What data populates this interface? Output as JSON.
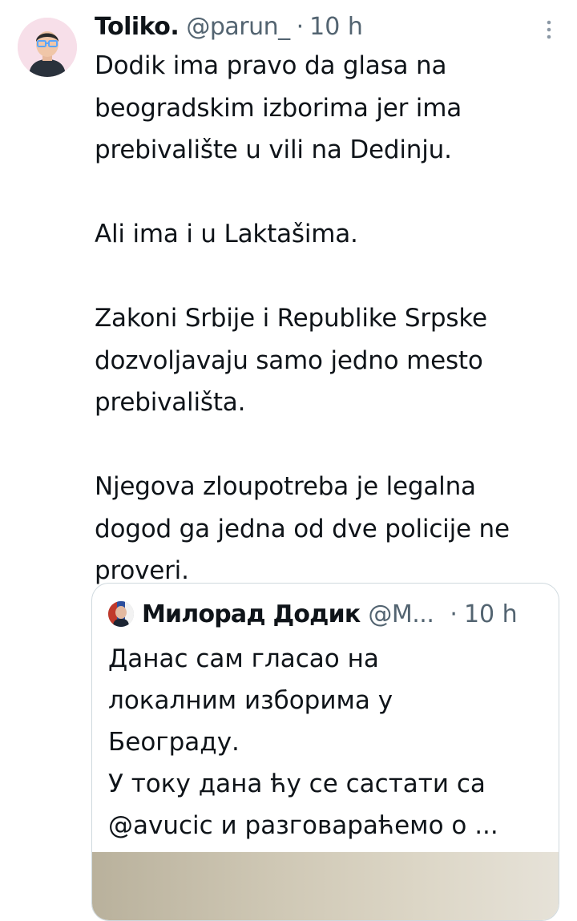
{
  "tweet": {
    "author": {
      "display_name": "Toliko.",
      "handle": "@parun_",
      "separator": "·",
      "time": "10 h"
    },
    "paragraphs": [
      "Dodik ima pravo da glasa na beogradskim izborima jer ima prebivalište u vili na Dedinju.",
      "Ali ima i u Laktašima.",
      "Zakoni Srbije i Republike Srpske dozvoljavaju samo jedno mesto prebivališta.",
      "Njegova zloupotreba je legalna dogod ga jedna od dve policije ne proveri."
    ],
    "icons": {
      "avatar": "avatar-illustration-icon",
      "more": "more-options-icon"
    }
  },
  "quoted_tweet": {
    "author": {
      "display_name": "Милорад Додик",
      "handle": "@M...",
      "separator": "·",
      "time": "10 h"
    },
    "lines": [
      "Данас сам гласао на",
      "локалним изборима у",
      "Београду.",
      "У току дана ћу се састати са",
      "@avucic и разговараћемо о ..."
    ]
  },
  "colors": {
    "text_primary": "#0f1419",
    "text_secondary": "#536471",
    "border": "#cfd9de",
    "avatar_bg": "#f7dfe9"
  }
}
